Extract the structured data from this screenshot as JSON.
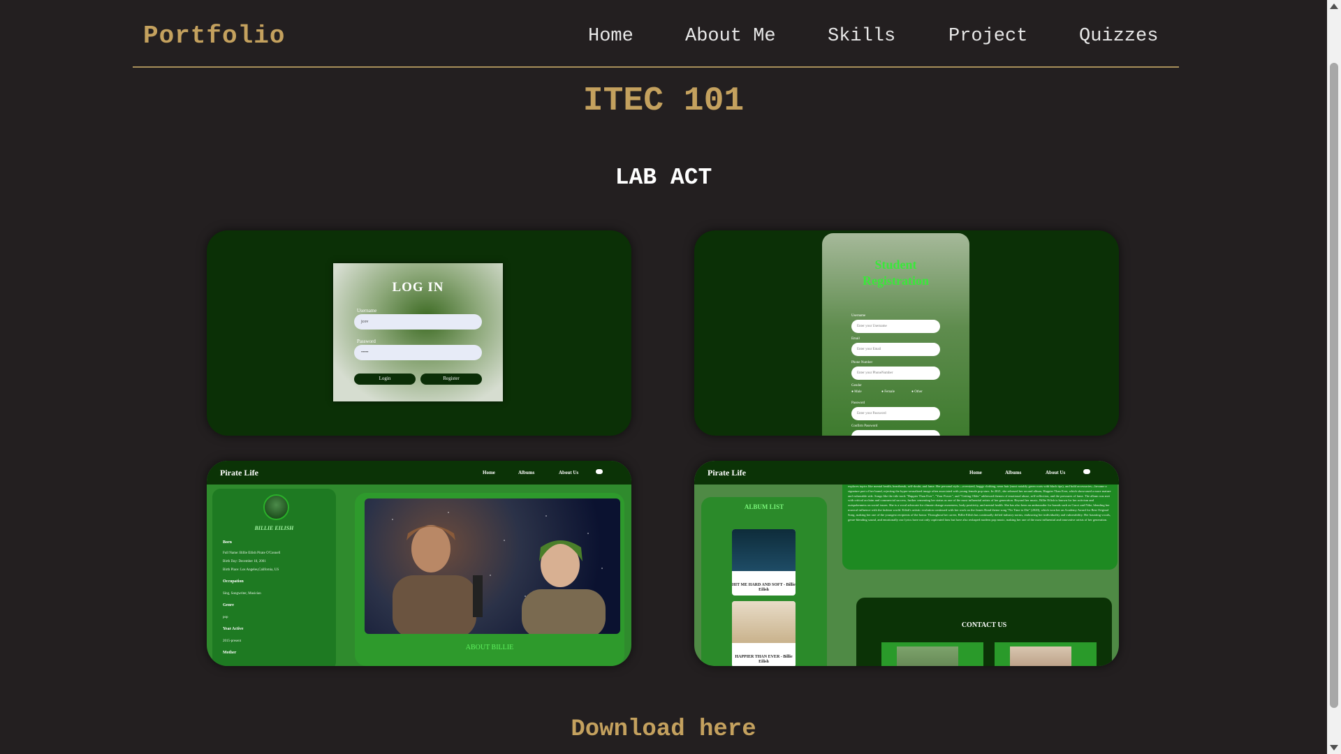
{
  "nav": {
    "brand": "Portfolio",
    "links": [
      "Home",
      "About Me",
      "Skills",
      "Project",
      "Quizzes"
    ]
  },
  "section": {
    "title": "ITEC 101",
    "subtitle": "LAB ACT"
  },
  "cards": {
    "login": {
      "title": "LOG IN",
      "username_label": "Username",
      "username_value": "jcov",
      "password_label": "Password",
      "password_value": "•••••",
      "login_btn": "Login",
      "register_btn": "Register"
    },
    "registration": {
      "title_line1": "Student",
      "title_line2": "Registration",
      "username_label": "Username",
      "username_placeholder": "Enter your Username",
      "email_label": "Email",
      "email_placeholder": "Enter your Email",
      "phone_label": "Phone Number",
      "phone_placeholder": "Enter your PhoneNumber",
      "gender_label": "Gender",
      "genders": [
        "Male",
        "Female",
        "Other"
      ],
      "password_label": "Password",
      "password_placeholder": "Enter your Password",
      "confirm_label": "Confirm Password"
    },
    "pirate_about": {
      "logo": "Pirate Life",
      "links": [
        "Home",
        "Albums",
        "About Us"
      ],
      "artist_name": "BILLIE EILISH",
      "born_head": "Born",
      "full_name": "Full Name: Billie Eilish Pirate O'Connell",
      "birth_day": "Birth Day: December 18, 2001",
      "birth_place": "Birth Place: Los Angeles,California, US",
      "occupation_head": "Occupation",
      "occupation": "Sing, Songwriter, Musician",
      "genre_head": "Genre",
      "genre": "pop",
      "years_head": "Year Active",
      "years": "2015-present",
      "mother_head": "Mother",
      "caption": "ABOUT BILLIE"
    },
    "pirate_albums": {
      "logo": "Pirate Life",
      "links": [
        "Home",
        "Albums",
        "About Us"
      ],
      "album_list_title": "ALBUM LIST",
      "album1": "HIT ME HARD AND SOFT - Billie Eilish",
      "album2": "HAPPIER THAN EVER - Billie Eilish",
      "about_text": "explores topics like mental health, heartbreak, self-doubt, and fame. Her personal style—oversized, baggy clothing, neon hair (most notably green roots with black tips), and bold accessories—became a signature part of her brand, rejecting the hyper-sexualized image often associated with young female pop stars. In 2021, she released her second album, Happier Than Ever, which showcased a more mature and vulnerable side. Songs like the title track \"Happier Than Ever\", \"Your Power\", and \"Getting Older\" addressed themes of emotional abuse, self-reflection, and the pressures of fame. The album was met with critical acclaim and commercial success, further cementing her status as one of the most influential artists of her generation. Beyond her music, Billie Eilish is known for her activism and outspokenness on social issues. She is a vocal advocate for climate change awareness, body positivity, and mental health. She has also been an ambassador for brands such as Gucci and Nike, blending her musical influence with the fashion world. Eilish's artistic evolution continued with her work on the James Bond theme song \"No Time to Die\" (2020), which won her an Academy Award for Best Original Song, making her one of the youngest recipients of the honor. Throughout her career, Billie Eilish has continually defied industry norms, embracing her individuality and vulnerability. Her haunting vocals, genre-blending sound, and emotionally raw lyrics have not only captivated fans but have also reshaped modern pop music, making her one of the most influential and innovative artists of her generation.",
      "contact_title": "CONTACT US"
    }
  },
  "download": "Download here",
  "colors": {
    "accent": "#c4a15e",
    "background": "#231f20",
    "card_green": "#0b3006"
  }
}
